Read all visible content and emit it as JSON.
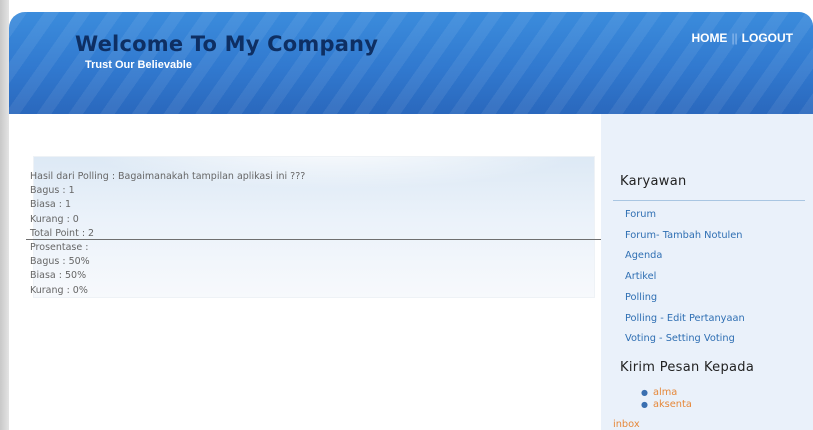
{
  "header": {
    "title": "Welcome To My Company",
    "subtitle": "Trust Our Believable",
    "nav": {
      "home": "HOME",
      "separator": "||",
      "logout": "LOGOUT"
    }
  },
  "poll": {
    "lines": [
      "Hasil dari Polling : Bagaimanakah tampilan aplikasi ini ???",
      "Bagus : 1",
      "Biasa : 1",
      "Kurang : 0",
      "Total Point : 2",
      "Prosentase :",
      "Bagus : 50%",
      "Biasa : 50%",
      "Kurang : 0%"
    ]
  },
  "sidebar": {
    "section_title": "Karyawan",
    "menu": [
      "Forum",
      "Forum- Tambah Notulen",
      "Agenda",
      "Artikel",
      "Polling",
      "Polling - Edit Pertanyaan",
      "Voting - Setting Voting"
    ],
    "message_title": "Kirim Pesan Kepada",
    "recipients": [
      "alma",
      "aksenta"
    ],
    "inbox": "inbox"
  },
  "colors": {
    "header_blue": "#3179cf",
    "title_navy": "#0e2f63",
    "sidebar_bg": "#eaf1fa",
    "link_blue": "#2f6fb3",
    "link_orange": "#e6883a"
  }
}
